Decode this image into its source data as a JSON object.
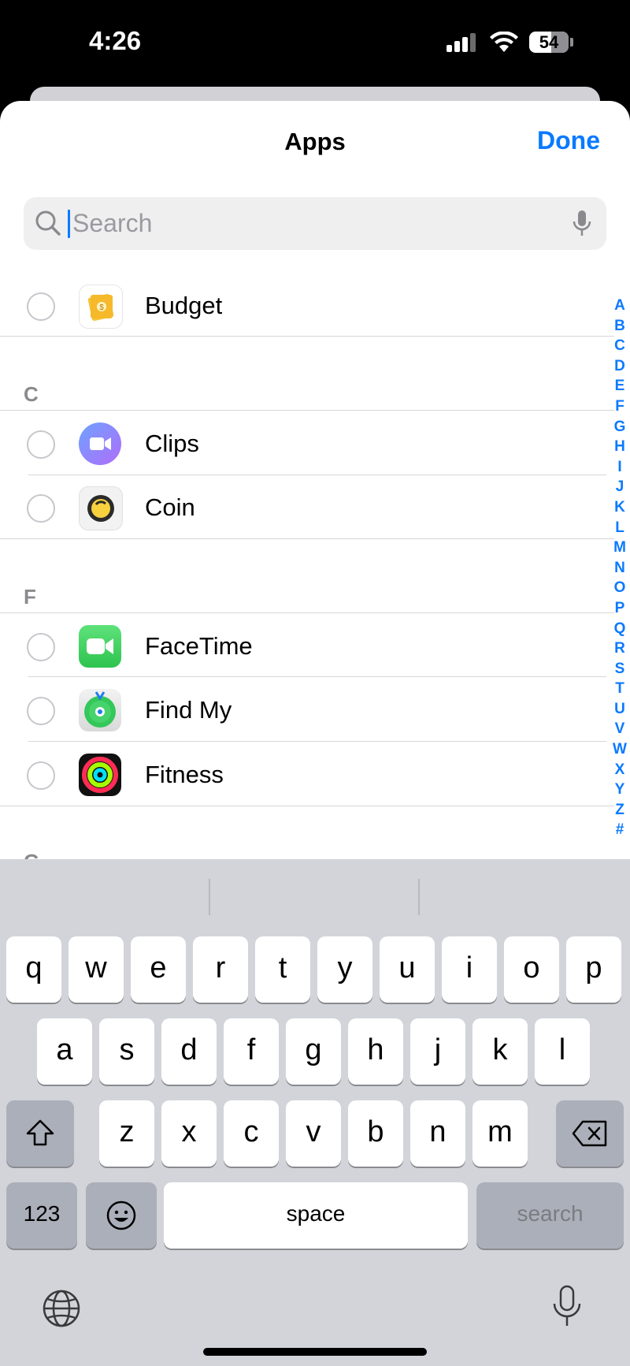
{
  "status": {
    "time": "4:26",
    "battery": "54"
  },
  "header": {
    "title": "Apps",
    "done_label": "Done"
  },
  "search": {
    "placeholder": "Search"
  },
  "list": {
    "sections": [
      "C",
      "F",
      "G"
    ],
    "apps": [
      {
        "name": "Budget",
        "icon": "budget-icon"
      },
      {
        "name": "Clips",
        "icon": "clips-icon"
      },
      {
        "name": "Coin",
        "icon": "coin-icon"
      },
      {
        "name": "FaceTime",
        "icon": "facetime-icon"
      },
      {
        "name": "Find My",
        "icon": "find-my-icon"
      },
      {
        "name": "Fitness",
        "icon": "fitness-icon"
      }
    ]
  },
  "index": [
    "A",
    "B",
    "C",
    "D",
    "E",
    "F",
    "G",
    "H",
    "I",
    "J",
    "K",
    "L",
    "M",
    "N",
    "O",
    "P",
    "Q",
    "R",
    "S",
    "T",
    "U",
    "V",
    "W",
    "X",
    "Y",
    "Z",
    "#"
  ],
  "keyboard": {
    "row1": [
      "q",
      "w",
      "e",
      "r",
      "t",
      "y",
      "u",
      "i",
      "o",
      "p"
    ],
    "row2": [
      "a",
      "s",
      "d",
      "f",
      "g",
      "h",
      "j",
      "k",
      "l"
    ],
    "row3": [
      "z",
      "x",
      "c",
      "v",
      "b",
      "n",
      "m"
    ],
    "numbers_label": "123",
    "space_label": "space",
    "search_label": "search"
  },
  "colors": {
    "accent": "#0a7aff",
    "keyboard_bg": "#d2d4da"
  }
}
